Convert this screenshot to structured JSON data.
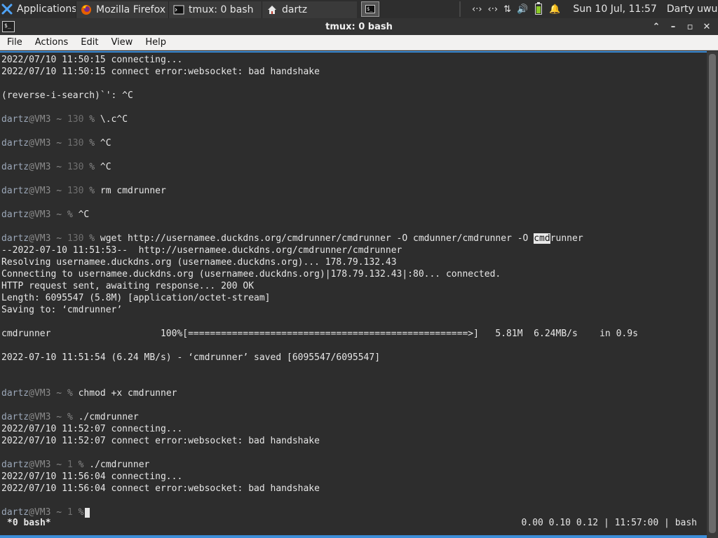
{
  "panel": {
    "app_menu": {
      "label": "Applications",
      "icon": "xfce-mouse-icon",
      "color": "#4fa3f7"
    },
    "tasks": [
      {
        "label": "Mozilla Firefox",
        "icon": "firefox-icon"
      },
      {
        "label": "tmux: 0 bash",
        "icon": "terminal-icon"
      },
      {
        "label": "dartz",
        "icon": "home-folder-icon"
      }
    ],
    "tray_icons": [
      {
        "name": "network-icon",
        "glyph": "‹·›"
      },
      {
        "name": "network-icon",
        "glyph": "‹·›"
      },
      {
        "name": "transfer-arrows-icon",
        "glyph": "⇅"
      },
      {
        "name": "volume-icon",
        "glyph": "🔊"
      }
    ],
    "battery_color": "#8ac926",
    "notification_glyph": "🔔",
    "clock": "Sun 10 Jul, 11:57",
    "user": "Darty uwu"
  },
  "window": {
    "title": "tmux: 0 bash",
    "controls": {
      "up": "⌃",
      "minimize": "–",
      "maximize": "▫",
      "close": "✕"
    }
  },
  "menubar": {
    "items": [
      "File",
      "Actions",
      "Edit",
      "View",
      "Help"
    ]
  },
  "terminal": {
    "prompt": {
      "user": "dartz",
      "host": "@VM3 ~ "
    },
    "lines": [
      "2022/07/10 11:50:15 connecting...",
      "2022/07/10 11:50:15 connect error:websocket: bad handshake",
      "",
      "(reverse-i-search)`': ^C",
      "",
      {
        "code": "130",
        "cmd": " \\.c^C"
      },
      "",
      {
        "code": "130",
        "cmd": " ^C"
      },
      "",
      {
        "code": "130",
        "cmd": " ^C"
      },
      "",
      {
        "code": "130",
        "cmd": " rm cmdrunner"
      },
      "",
      {
        "code": "",
        "cmd": " ^C"
      },
      "",
      {
        "code": "130",
        "cmd": " wget http://usernamee.duckdns.org/cmdrunner/cmdrunner -O cmdunner/cmdrunner -O ",
        "hl": "cmd",
        "after": "runner"
      },
      "--2022-07-10 11:51:53--  http://usernamee.duckdns.org/cmdrunner/cmdrunner",
      "Resolving usernamee.duckdns.org (usernamee.duckdns.org)... 178.79.132.43",
      "Connecting to usernamee.duckdns.org (usernamee.duckdns.org)|178.79.132.43|:80... connected.",
      "HTTP request sent, awaiting response... 200 OK",
      "Length: 6095547 (5.8M) [application/octet-stream]",
      "Saving to: ‘cmdrunner’",
      "",
      "cmdrunner                    100%[===================================================>]   5.81M  6.24MB/s    in 0.9s",
      "",
      "2022-07-10 11:51:54 (6.24 MB/s) - ‘cmdrunner’ saved [6095547/6095547]",
      "",
      "",
      {
        "code": "",
        "cmd": " chmod +x cmdrunner"
      },
      "",
      {
        "code": "",
        "cmd": " ./cmdrunner"
      },
      "2022/07/10 11:52:07 connecting...",
      "2022/07/10 11:52:07 connect error:websocket: bad handshake",
      "",
      {
        "code": "1",
        "cmd": " ./cmdrunner"
      },
      "2022/07/10 11:56:04 connecting...",
      "2022/07/10 11:56:04 connect error:websocket: bad handshake",
      "",
      {
        "code": "1",
        "cmd": "",
        "cursor": true
      }
    ],
    "status_left": " *0 bash*",
    "status_right": "0.00 0.10 0.12 | 11:57:00 | bash"
  }
}
